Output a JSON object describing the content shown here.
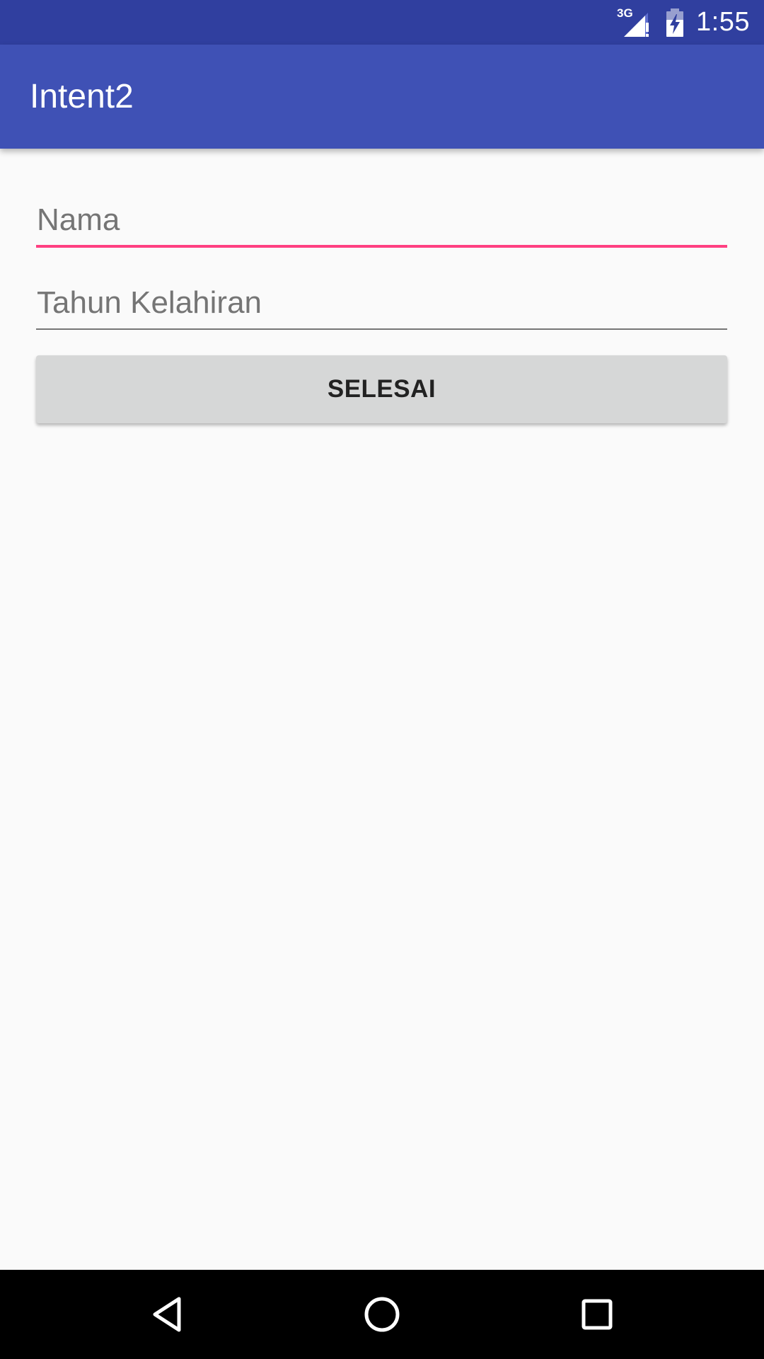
{
  "status_bar": {
    "network_label": "3G",
    "time": "1:55",
    "icons": [
      "signal-icon",
      "battery-charging-icon"
    ]
  },
  "app_bar": {
    "title": "Intent2",
    "color": "#3f51b5"
  },
  "form": {
    "nama": {
      "value": "",
      "placeholder": "Nama",
      "focused": true,
      "accent_color": "#ff4081"
    },
    "tahun_kelahiran": {
      "value": "",
      "placeholder": "Tahun Kelahiran",
      "focused": false
    },
    "submit_label": "SELESAI"
  },
  "nav_bar": {
    "icons": [
      "back-icon",
      "home-icon",
      "recent-apps-icon"
    ]
  },
  "colors": {
    "status_bar": "#303f9f",
    "primary": "#3f51b5",
    "accent": "#ff4081",
    "background": "#fafafa",
    "button": "#d6d7d7"
  }
}
